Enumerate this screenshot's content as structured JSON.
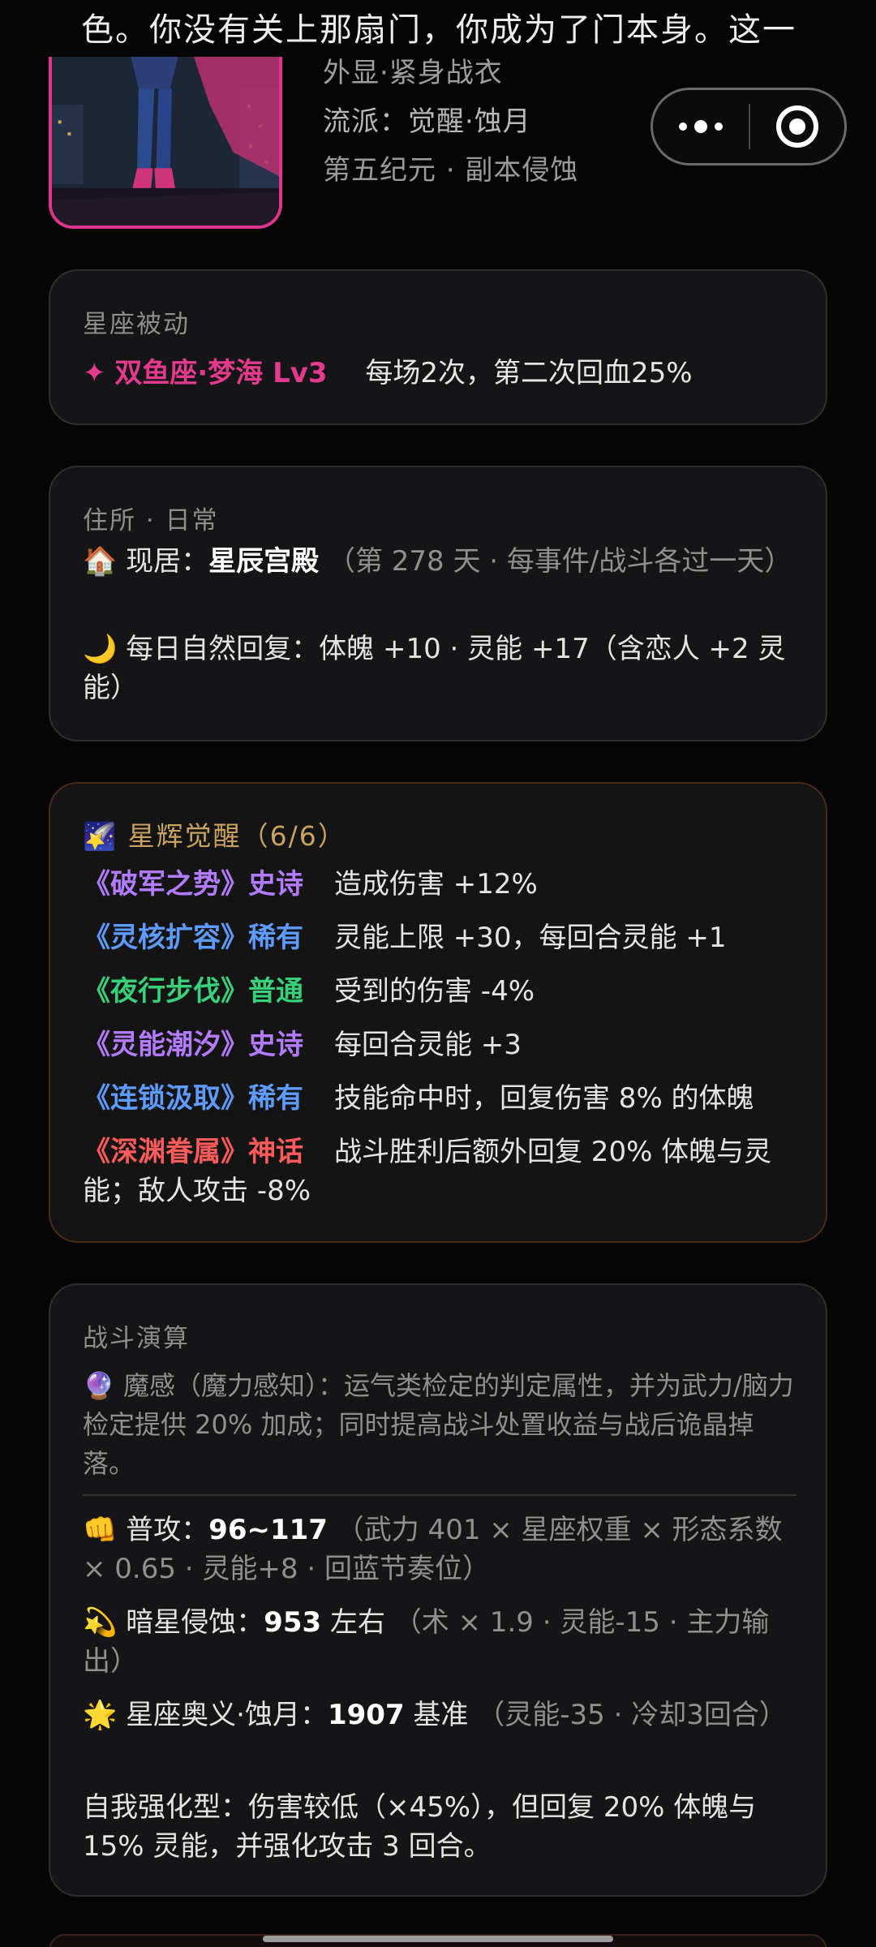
{
  "story": {
    "top_fragment": "色。你没有关上那扇门，你成为了门本身。这一"
  },
  "profile": {
    "outfit": "外显·紧身战衣",
    "school": "流派：觉醒·蚀月",
    "era": "第五纪元 · 副本侵蚀"
  },
  "capsule": {
    "more_icon": "more-dots-icon",
    "close_icon": "record-close-icon"
  },
  "constellation": {
    "title": "星座被动",
    "icon": "✦",
    "name": "双鱼座·梦海 Lv3",
    "desc": "每场2次，第二次回血25%",
    "accent": "#e43a8e"
  },
  "residence": {
    "title": "住所 · 日常",
    "home_emoji": "🏠",
    "home_label": "现居：",
    "home_name": "星辰宫殿",
    "home_note": "（第 278 天 · 每事件/战斗各过一天）",
    "moon_emoji": "🌙",
    "regen": "每日自然回复：体魄 +10 · 灵能 +17（含恋人 +2 灵能）"
  },
  "awakening": {
    "emoji": "🌠",
    "title": "星辉觉醒（6/6）",
    "items": [
      {
        "tag": "《破军之势》史诗",
        "desc": "造成伤害 +12%",
        "rarity_color": "#b37bff"
      },
      {
        "tag": "《灵核扩容》稀有",
        "desc": "灵能上限 +30，每回合灵能 +1",
        "rarity_color": "#5e9bff"
      },
      {
        "tag": "《夜行步伐》普通",
        "desc": "受到的伤害 -4%",
        "rarity_color": "#39d07a"
      },
      {
        "tag": "《灵能潮汐》史诗",
        "desc": "每回合灵能 +3",
        "rarity_color": "#b37bff"
      },
      {
        "tag": "《连锁汲取》稀有",
        "desc": "技能命中时，回复伤害 8% 的体魄",
        "rarity_color": "#5e9bff"
      },
      {
        "tag": "《深渊眷属》神话",
        "desc": "战斗胜利后额外回复 20% 体魄与灵能；敌人攻击 -8%",
        "rarity_color": "#ff5b5b"
      }
    ]
  },
  "battle": {
    "title": "战斗演算",
    "sense_emoji": "🔮",
    "sense": "魔感（魔力感知）：运气类检定的判定属性，并为武力/脑力检定提供 20% 加成；同时提高战斗处置收益与战后诡晶掉落。",
    "attacks": [
      {
        "emoji": "👊",
        "label": "普攻：",
        "value": "96~117",
        "suffix": "",
        "note": "（武力 401 × 星座权重 × 形态系数 × 0.65 · 灵能+8 · 回蓝节奏位）"
      },
      {
        "emoji": "💫",
        "label": "暗星侵蚀：",
        "value": "953",
        "suffix": " 左右",
        "note": "（术 × 1.9 · 灵能-15 · 主力输出）"
      },
      {
        "emoji": "🌟",
        "label": "星座奥义·蚀月：",
        "value": "1907",
        "suffix": " 基准",
        "note": "（灵能-35 · 冷却3回合）"
      }
    ],
    "self_buff": "自我强化型：伤害较低（×45%），但回复 20% 体魄与 15% 灵能，并强化攻击 3 回合。"
  }
}
